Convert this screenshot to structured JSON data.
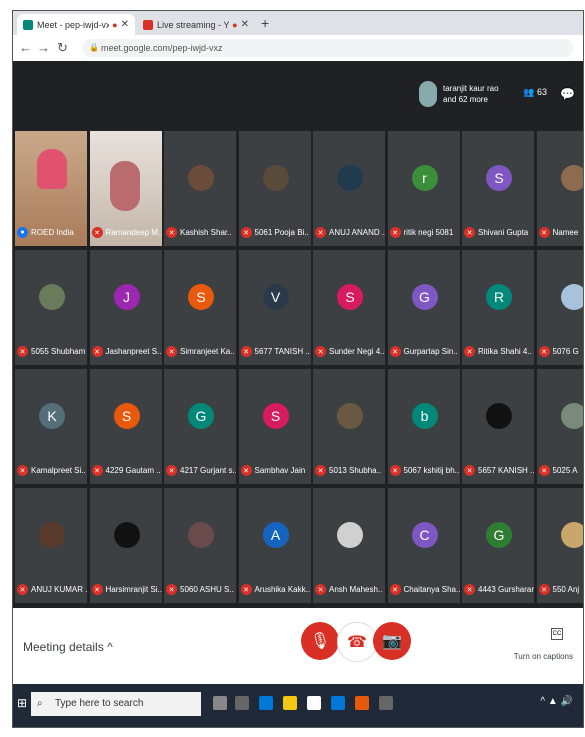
{
  "browser": {
    "tab_active": "Meet - pep-iwjd-vxz",
    "tab_inactive": "Live streaming - YouTube St",
    "url": "meet.google.com/pep-iwjd-vxz"
  },
  "meet": {
    "participant_summary": "taranjit kaur rao and 62 more",
    "people_count": "63",
    "meeting_details": "Meeting details",
    "captions_label": "Turn on captions",
    "taskbar_search": "Type here to search"
  },
  "tiles": [
    {
      "name": "ROED India",
      "avatar": "",
      "color": "",
      "kind": "video1"
    },
    {
      "name": "Ramandeep M..",
      "avatar": "",
      "color": "",
      "kind": "video2"
    },
    {
      "name": "Kashish Shar..",
      "avatar": "",
      "color": "#6b4c3b",
      "kind": "photo"
    },
    {
      "name": "5061 Pooja Bi..",
      "avatar": "",
      "color": "#5a4a3a",
      "kind": "photo"
    },
    {
      "name": "ANUJ ANAND ..",
      "avatar": "",
      "color": "#1f3b4d",
      "kind": "photo"
    },
    {
      "name": "ritik negi 5081",
      "avatar": "r",
      "color": "#3b8f3a",
      "kind": "letter"
    },
    {
      "name": "Shivani Gupta",
      "avatar": "S",
      "color": "#7e57c2",
      "kind": "letter"
    },
    {
      "name": "Namee",
      "avatar": "",
      "color": "#8c6b4f",
      "kind": "photo"
    },
    {
      "name": "5055 Shubham",
      "avatar": "",
      "color": "#6a7b5a",
      "kind": "photo"
    },
    {
      "name": "Jashanpreet S..",
      "avatar": "J",
      "color": "#9c27b0",
      "kind": "letter"
    },
    {
      "name": "Simranjeet Ka..",
      "avatar": "S",
      "color": "#e8590c",
      "kind": "letter"
    },
    {
      "name": "5677 TANISH ..",
      "avatar": "V",
      "color": "#2b3a4a",
      "kind": "letter"
    },
    {
      "name": "Sunder Negi 4..",
      "avatar": "S",
      "color": "#d81b60",
      "kind": "letter"
    },
    {
      "name": "Gurpartap Sin..",
      "avatar": "G",
      "color": "#7e57c2",
      "kind": "letter"
    },
    {
      "name": "Ritika Shahi 4..",
      "avatar": "R",
      "color": "#00897b",
      "kind": "letter"
    },
    {
      "name": "5076 G",
      "avatar": "",
      "color": "#a8c1dc",
      "kind": "photo"
    },
    {
      "name": "Kamalpreet Si..",
      "avatar": "K",
      "color": "#546e7a",
      "kind": "letter"
    },
    {
      "name": "4229 Gautam ..",
      "avatar": "S",
      "color": "#e8590c",
      "kind": "letter"
    },
    {
      "name": "4217 Gurjant s..",
      "avatar": "G",
      "color": "#00897b",
      "kind": "letter"
    },
    {
      "name": "Sambhav Jain",
      "avatar": "S",
      "color": "#d81b60",
      "kind": "letter"
    },
    {
      "name": "5013 Shubha..",
      "avatar": "",
      "color": "#6b5842",
      "kind": "photo"
    },
    {
      "name": "5067 kshitij bh..",
      "avatar": "b",
      "color": "#00897b",
      "kind": "letter"
    },
    {
      "name": "5657 KANISH ..",
      "avatar": "",
      "color": "#111111",
      "kind": "photo"
    },
    {
      "name": "5025 A",
      "avatar": "",
      "color": "#7a8a7a",
      "kind": "photo"
    },
    {
      "name": "ANUJ KUMAR ..",
      "avatar": "",
      "color": "#5a3a2a",
      "kind": "photo"
    },
    {
      "name": "Harsimranjit Si..",
      "avatar": "",
      "color": "#111111",
      "kind": "photo"
    },
    {
      "name": "5060 ASHU S..",
      "avatar": "",
      "color": "#6a4a4a",
      "kind": "photo"
    },
    {
      "name": "Arushika Kakk..",
      "avatar": "A",
      "color": "#1565c0",
      "kind": "letter"
    },
    {
      "name": "Ansh Mahesh..",
      "avatar": "",
      "color": "#d0d0d0",
      "kind": "photo"
    },
    {
      "name": "Chaitanya Sha..",
      "avatar": "C",
      "color": "#7e57c2",
      "kind": "letter"
    },
    {
      "name": "4443 Gursharan",
      "avatar": "G",
      "color": "#2e7d32",
      "kind": "letter"
    },
    {
      "name": "550 Anj",
      "avatar": "",
      "color": "#c9a66b",
      "kind": "photo"
    }
  ]
}
